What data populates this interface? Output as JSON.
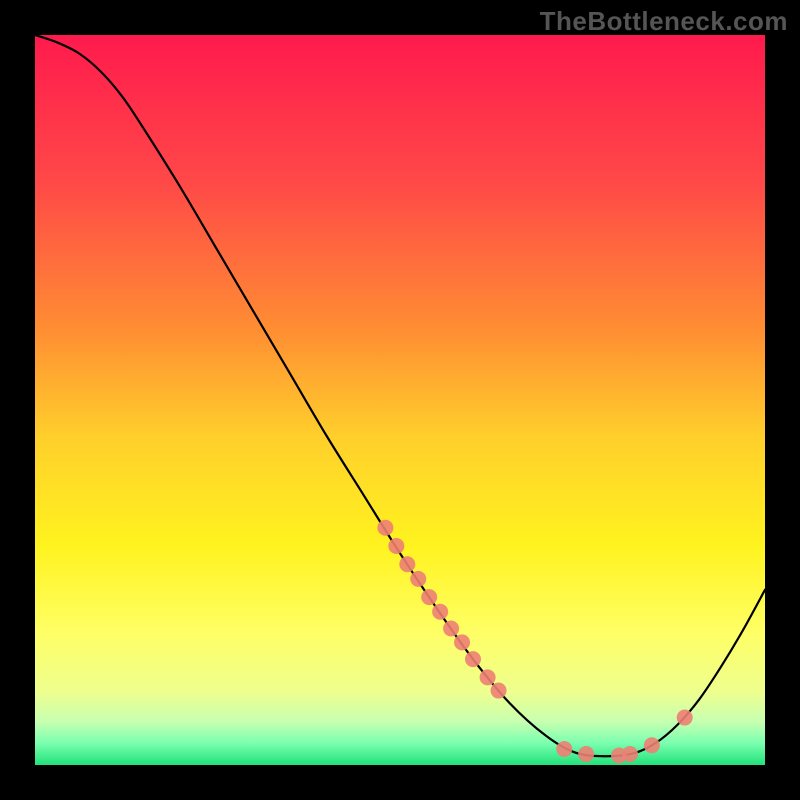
{
  "watermark": "TheBottleneck.com",
  "chart_data": {
    "type": "line",
    "title": "",
    "xlabel": "",
    "ylabel": "",
    "xlim": [
      0,
      100
    ],
    "ylim": [
      0,
      100
    ],
    "grid": false,
    "background_gradient_stops": [
      {
        "offset": 0.0,
        "color": "#ff1a4d"
      },
      {
        "offset": 0.2,
        "color": "#ff4848"
      },
      {
        "offset": 0.4,
        "color": "#ff8c33"
      },
      {
        "offset": 0.55,
        "color": "#ffcf2b"
      },
      {
        "offset": 0.7,
        "color": "#fff31f"
      },
      {
        "offset": 0.82,
        "color": "#ffff66"
      },
      {
        "offset": 0.9,
        "color": "#eeff8e"
      },
      {
        "offset": 0.94,
        "color": "#c8ffb0"
      },
      {
        "offset": 0.97,
        "color": "#7bffb0"
      },
      {
        "offset": 1.0,
        "color": "#21e27a"
      }
    ],
    "series": [
      {
        "name": "bottleneck-curve",
        "stroke": "#000000",
        "stroke_width": 2.2,
        "points": [
          {
            "x": 0.0,
            "y": 100.0
          },
          {
            "x": 3.0,
            "y": 99.0
          },
          {
            "x": 6.0,
            "y": 97.5
          },
          {
            "x": 9.0,
            "y": 95.0
          },
          {
            "x": 12.0,
            "y": 91.5
          },
          {
            "x": 15.0,
            "y": 87.0
          },
          {
            "x": 20.0,
            "y": 79.0
          },
          {
            "x": 25.0,
            "y": 70.5
          },
          {
            "x": 30.0,
            "y": 62.0
          },
          {
            "x": 35.0,
            "y": 53.5
          },
          {
            "x": 40.0,
            "y": 45.0
          },
          {
            "x": 45.0,
            "y": 37.0
          },
          {
            "x": 50.0,
            "y": 29.0
          },
          {
            "x": 55.0,
            "y": 21.5
          },
          {
            "x": 60.0,
            "y": 14.5
          },
          {
            "x": 65.0,
            "y": 8.5
          },
          {
            "x": 70.0,
            "y": 4.0
          },
          {
            "x": 74.0,
            "y": 1.7
          },
          {
            "x": 78.0,
            "y": 1.2
          },
          {
            "x": 82.0,
            "y": 1.6
          },
          {
            "x": 85.0,
            "y": 3.0
          },
          {
            "x": 88.0,
            "y": 5.5
          },
          {
            "x": 91.0,
            "y": 9.0
          },
          {
            "x": 94.0,
            "y": 13.5
          },
          {
            "x": 97.0,
            "y": 18.5
          },
          {
            "x": 100.0,
            "y": 24.0
          }
        ]
      }
    ],
    "markers": {
      "fill": "#ed7f74",
      "fill_opacity": 0.9,
      "radius": 8,
      "points": [
        {
          "x": 48.0,
          "y": 32.5
        },
        {
          "x": 49.5,
          "y": 30.0
        },
        {
          "x": 51.0,
          "y": 27.5
        },
        {
          "x": 52.5,
          "y": 25.5
        },
        {
          "x": 54.0,
          "y": 23.0
        },
        {
          "x": 55.5,
          "y": 21.0
        },
        {
          "x": 57.0,
          "y": 18.7
        },
        {
          "x": 58.5,
          "y": 16.8
        },
        {
          "x": 60.0,
          "y": 14.5
        },
        {
          "x": 62.0,
          "y": 12.0
        },
        {
          "x": 63.5,
          "y": 10.2
        },
        {
          "x": 72.5,
          "y": 2.2
        },
        {
          "x": 75.5,
          "y": 1.5
        },
        {
          "x": 80.0,
          "y": 1.3
        },
        {
          "x": 81.5,
          "y": 1.5
        },
        {
          "x": 84.5,
          "y": 2.7
        },
        {
          "x": 89.0,
          "y": 6.5
        }
      ]
    }
  }
}
